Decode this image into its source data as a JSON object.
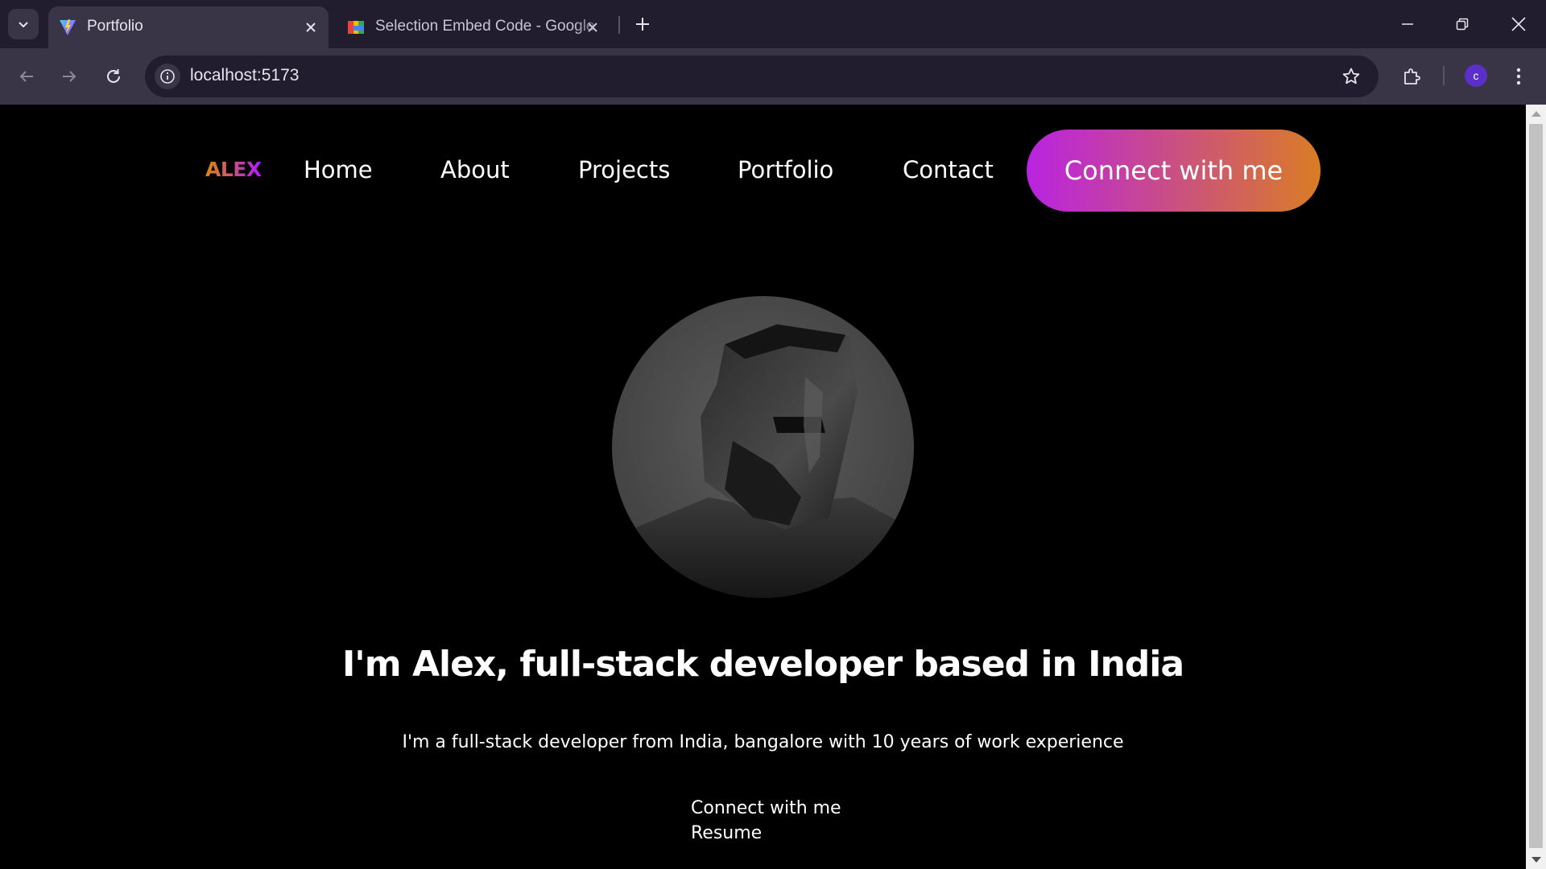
{
  "browser": {
    "tabs": [
      {
        "title": "Portfolio",
        "active": true,
        "favicon": "vite-icon"
      },
      {
        "title": "Selection Embed Code - Google",
        "active": false,
        "favicon": "google-apps-icon"
      }
    ],
    "url": "localhost:5173",
    "profile_initial": "c"
  },
  "navbar": {
    "logo": "ALEX",
    "links": [
      "Home",
      "About",
      "Projects",
      "Portfolio",
      "Contact"
    ],
    "cta": "Connect with me"
  },
  "hero": {
    "title": "I'm Alex, full-stack developer based in India",
    "subtitle": "I'm a full-stack developer from India, bangalore with 10 years of work experience",
    "actions": [
      "Connect with me",
      "Resume"
    ]
  },
  "colors": {
    "background": "#000000",
    "chrome_dark": "#211c2e",
    "chrome_light": "#3a3447",
    "gradient_start": "#b923e1",
    "gradient_end": "#da7c25",
    "text": "#ffffff"
  }
}
